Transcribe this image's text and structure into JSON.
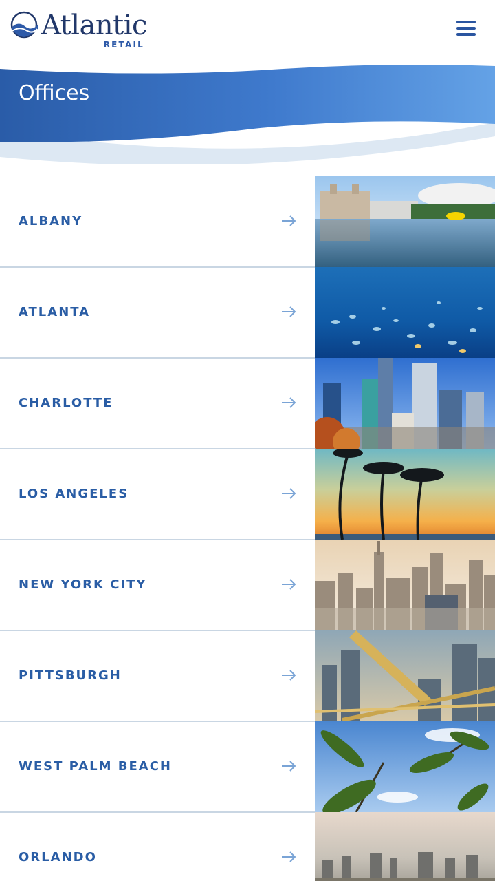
{
  "brand": {
    "name": "Atlantic",
    "sub": "RETAIL",
    "color_primary": "#2a5da5",
    "color_dark": "#22386a"
  },
  "header": {
    "menu_icon": "hamburger-menu-icon"
  },
  "banner": {
    "title": "Offices"
  },
  "offices": [
    {
      "name": "ALBANY",
      "image": "albany-capitol-reflecting-pool"
    },
    {
      "name": "ATLANTA",
      "image": "atlanta-aquarium-fish"
    },
    {
      "name": "CHARLOTTE",
      "image": "charlotte-skyline"
    },
    {
      "name": "LOS ANGELES",
      "image": "los-angeles-palm-sunset"
    },
    {
      "name": "NEW YORK CITY",
      "image": "new-york-city-skyline"
    },
    {
      "name": "PITTSBURGH",
      "image": "pittsburgh-bridge-skyline"
    },
    {
      "name": "WEST PALM BEACH",
      "image": "west-palm-beach-palms-sky"
    },
    {
      "name": "ORLANDO",
      "image": "orlando-aerial-skyline"
    }
  ]
}
